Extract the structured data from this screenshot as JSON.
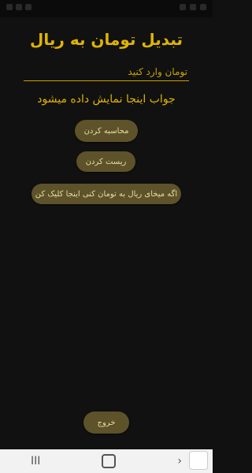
{
  "title": "تبدیل تومان به ریال",
  "input": {
    "placeholder": "تومان وارد کنید",
    "value": ""
  },
  "answer_text": "جواب اینجا نمایش داده میشود",
  "buttons": {
    "calculate": "محاسبه کردن",
    "reset": "ریست کردن",
    "rial_to_toman": "اگه میخای ریال به تومان کنی اینجا کلیک کن",
    "exit": "خروج"
  },
  "nav": {
    "recents": "III",
    "back": "›"
  },
  "colors": {
    "accent": "#e0b400",
    "button_bg": "#5d5229",
    "background": "#111111"
  }
}
